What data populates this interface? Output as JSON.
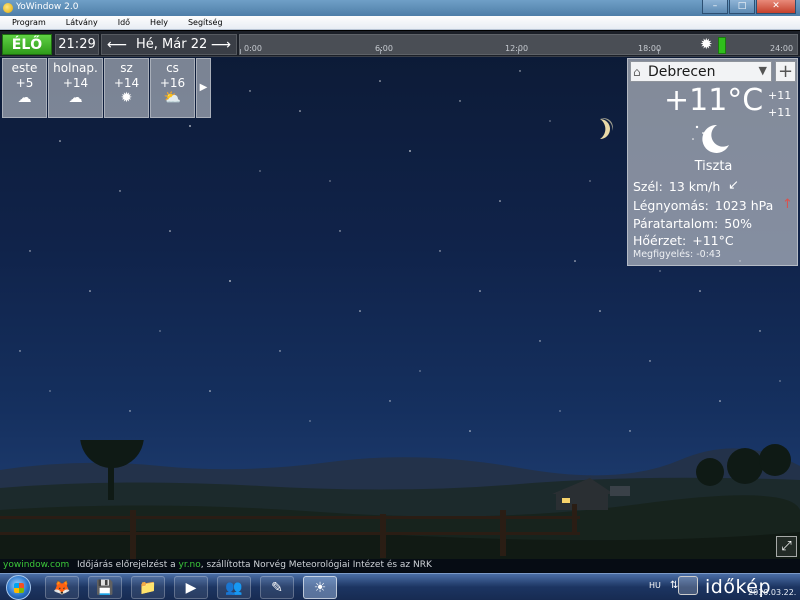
{
  "window": {
    "title": "YoWindow 2.0",
    "buttons": {
      "minimize": "–",
      "maximize": "□",
      "close": "✕"
    }
  },
  "menu": [
    "Program",
    "Látvány",
    "Idő",
    "Hely",
    "Segítség"
  ],
  "timebar": {
    "live_label": "ÉLŐ",
    "time": "21:29",
    "date": "Hé, Már 22",
    "ticks": [
      "0:00",
      "6:00",
      "12:00",
      "18:00",
      "24:00"
    ]
  },
  "forecast": {
    "days": [
      {
        "label": "este",
        "temp": "+5",
        "icon": "cloud-icon"
      },
      {
        "label": "holnap.",
        "temp": "+14",
        "icon": "cloud-icon"
      },
      {
        "label": "sz",
        "temp": "+14",
        "icon": "sun-icon"
      },
      {
        "label": "cs",
        "temp": "+16",
        "icon": "partly-cloudy-icon"
      }
    ],
    "next_label": "▶"
  },
  "panel": {
    "location": "Debrecen",
    "temperature": "+11°C",
    "high": "+11",
    "low": "+11",
    "condition": "Tiszta",
    "condition_icon": "moon-stars-icon",
    "wind_label": "Szél:",
    "wind_value": "13 km/h",
    "wind_arrow": "↙",
    "pressure_label": "Légnyomás:",
    "pressure_value": "1023 hPa",
    "pressure_arrow": "↑",
    "humidity_label": "Páratartalom:",
    "humidity_value": "50%",
    "feels_label": "Hőérzet:",
    "feels_value": "+11°C",
    "obs_label": "Megfigyelés:",
    "obs_value": "-0:43"
  },
  "status": {
    "site": "yowindow.com",
    "credit_pre": "Időjárás előrejelzést a ",
    "credit_src": "yr.no",
    "credit_post": ", szállította Norvég Meteorológiai Intézet és az NRK"
  },
  "taskbar": {
    "apps": [
      "firefox-icon",
      "save-icon",
      "folder-icon",
      "media-player-icon",
      "messenger-icon",
      "tools-icon",
      "yowindow-icon"
    ],
    "lang": "HU",
    "watermark": "időkép",
    "clock": "2010.03.22."
  },
  "colors": {
    "live_green": "#2f9b1a",
    "site_green": "#3cc83a",
    "sky_top": "#0c1a35"
  }
}
